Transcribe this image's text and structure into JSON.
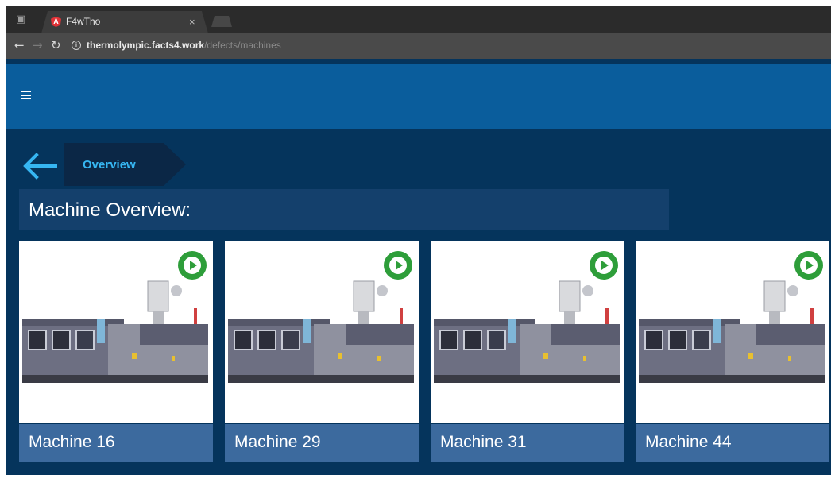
{
  "browser": {
    "tab_title": "F4wTho",
    "tab_close": "×",
    "url_host": "thermolympic.facts4.work",
    "url_path": "/defects/machines"
  },
  "breadcrumb": {
    "label": "Overview"
  },
  "page": {
    "title": "Machine Overview:"
  },
  "machines": [
    {
      "label": "Machine 16"
    },
    {
      "label": "Machine 29"
    },
    {
      "label": "Machine 31"
    },
    {
      "label": "Machine 44"
    }
  ],
  "colors": {
    "page_bg": "#05345c",
    "header_bg": "#0a5d9c",
    "accent": "#36b6f2",
    "card_label_bg": "#3c6a9e",
    "play_button": "#2e9e3a"
  },
  "icons": {
    "menu": "hamburger-icon",
    "back": "back-arrow-icon",
    "play": "play-icon"
  }
}
